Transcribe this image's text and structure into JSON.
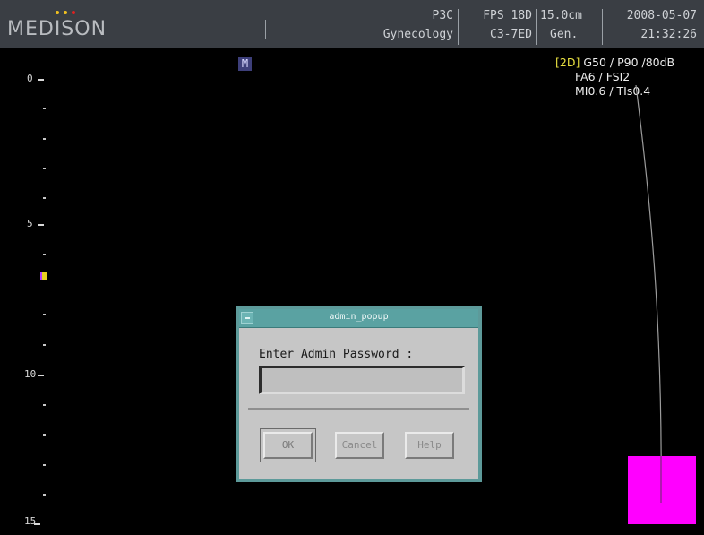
{
  "header": {
    "logo": "MEDISON",
    "logo_dot_colors": [
      "#f0c020",
      "#f0c020",
      "#e02020"
    ],
    "probe": "P3C",
    "application": "Gynecology",
    "fps": "FPS 18D",
    "transducer": "C3-7ED",
    "depth": "15.0cm",
    "mode": "Gen.",
    "date": "2008-05-07",
    "time": "21:32:26"
  },
  "scale": {
    "labels": [
      "0",
      "5",
      "10",
      "15"
    ]
  },
  "mode_indicator": "M",
  "params": {
    "mode_tag": "[2D]",
    "line1": "G50 / P90 /80dB",
    "line2": "FA6 / FSI2",
    "line3": "MI0.6 / TIs0.4"
  },
  "dialog": {
    "title": "admin_popup",
    "prompt": "Enter Admin Password :",
    "password_value": "",
    "ok_label": "OK",
    "cancel_label": "Cancel",
    "help_label": "Help"
  },
  "colors": {
    "background": "#000000",
    "header_bg": "#3a3e44",
    "dialog_frame": "#5d9a9a",
    "dialog_body": "#c6c6c6",
    "marker": "#ff00ff",
    "param_tag": "#e9e040"
  }
}
